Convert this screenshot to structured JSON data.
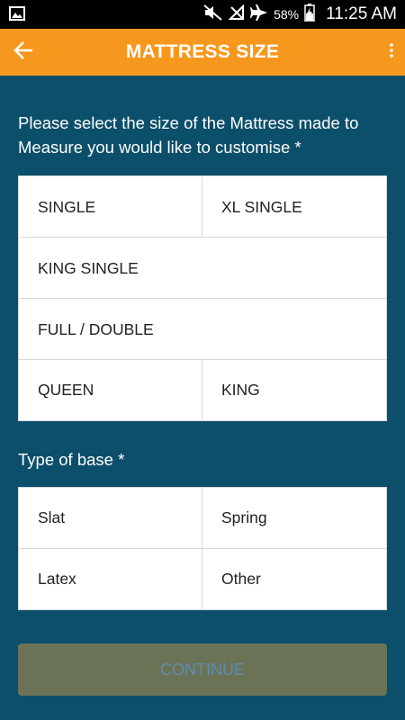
{
  "status_bar": {
    "left_icon": "image-icon",
    "battery_pct": "58%",
    "time": "11:25 AM",
    "icons": [
      "mute-icon",
      "no-signal-icon",
      "airplane-icon",
      "battery-charging-icon"
    ]
  },
  "app_bar": {
    "title": "MATTRESS SIZE",
    "back_icon": "back-arrow-icon",
    "menu_icon": "more-vert-icon",
    "background_color": "#f7981e"
  },
  "size_section": {
    "prompt": "Please select the size of the Mattress made to Measure you would like to customise *",
    "options": [
      "SINGLE",
      "XL SINGLE",
      "KING SINGLE",
      "FULL / DOUBLE",
      "QUEEN",
      "KING"
    ]
  },
  "base_section": {
    "prompt": "Type of base *",
    "options": [
      "Slat",
      "Spring",
      "Latex",
      "Other"
    ]
  },
  "continue_button": {
    "label": "CONTINUE",
    "enabled": false
  },
  "colors": {
    "page_background": "#0c4f6b",
    "accent": "#f7981e",
    "button_disabled": "#6b7356"
  }
}
